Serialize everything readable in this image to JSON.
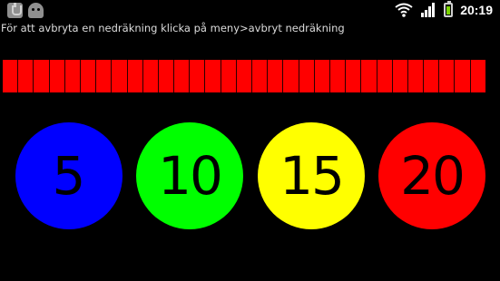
{
  "status_bar": {
    "time": "20:19",
    "icons": [
      "usb-icon",
      "debug-icon",
      "wifi-icon",
      "signal-icon",
      "battery-icon"
    ],
    "battery_color": "#7bd400"
  },
  "instruction_text": "För att avbryta en nedräkning klicka på meny>avbryt nedräkning",
  "progress": {
    "segments": 31,
    "fraction": 1.0,
    "color": "#ff0000"
  },
  "timer_buttons": [
    {
      "label": "5",
      "color": "#0000ff"
    },
    {
      "label": "10",
      "color": "#00ff00"
    },
    {
      "label": "15",
      "color": "#ffff00"
    },
    {
      "label": "20",
      "color": "#ff0000"
    }
  ]
}
